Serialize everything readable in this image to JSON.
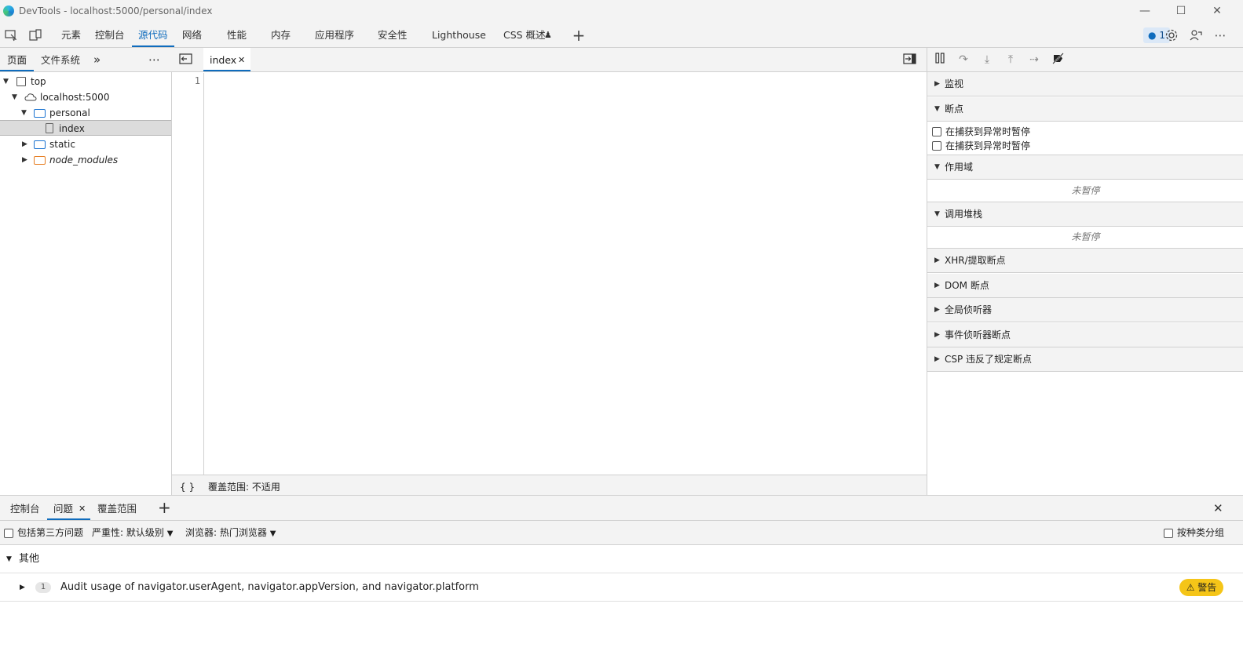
{
  "window": {
    "title": "DevTools - localhost:5000/personal/index",
    "minimize_glyph": "—",
    "maximize_glyph": "☐",
    "close_glyph": "✕"
  },
  "main_tabs": [
    {
      "label": "元素"
    },
    {
      "label": "控制台"
    },
    {
      "label": "源代码"
    },
    {
      "label": "网络"
    },
    {
      "label": "性能"
    },
    {
      "label": "内存"
    },
    {
      "label": "应用程序"
    },
    {
      "label": "安全性"
    },
    {
      "label": "Lighthouse"
    },
    {
      "label": "CSS 概述"
    }
  ],
  "active_main_tab": "源代码",
  "toolbar": {
    "add_tab_glyph": "+",
    "issues_count": "1",
    "more_glyph": "⋯",
    "experiment_glyph": "♟"
  },
  "navigator": {
    "tabs": [
      {
        "label": "页面"
      },
      {
        "label": "文件系统"
      }
    ],
    "more_tabs_glyph": "»",
    "menu_glyph": "⋯",
    "tree": [
      {
        "label": "top",
        "expanded": true
      },
      {
        "label": "localhost:5000",
        "expanded": true
      },
      {
        "label": "personal",
        "expanded": true
      },
      {
        "label": "index",
        "selected": true
      },
      {
        "label": "static",
        "expanded": false
      },
      {
        "label": "node_modules",
        "expanded": false,
        "italic": true
      }
    ]
  },
  "editor": {
    "open_file": "index",
    "close_glyph": "✕",
    "line_numbers": [
      "1"
    ],
    "pretty_print_glyph": "{ }",
    "coverage_status": "覆盖范围: 不适用"
  },
  "debugger": {
    "sections": {
      "watch": "监视",
      "breakpoints": "断点",
      "scope": "作用域",
      "call_stack": "调用堆栈",
      "xhr": "XHR/提取断点",
      "dom": "DOM 断点",
      "global_listeners": "全局侦听器",
      "event_listener_breakpoints": "事件侦听器断点",
      "csp": "CSP 违反了规定断点"
    },
    "breakpoint_options": [
      {
        "label": "在捕获到异常时暂停",
        "checked": false
      },
      {
        "label": "在捕获到异常时暂停",
        "checked": false
      }
    ],
    "scope_status": "未暂停",
    "call_stack_status": "未暂停"
  },
  "drawer": {
    "tabs": [
      {
        "label": "控制台"
      },
      {
        "label": "问题"
      },
      {
        "label": "覆盖范围"
      }
    ],
    "active_tab": "问题",
    "close_glyph": "✕",
    "add_glyph": "+",
    "include_third_party": "包括第三方问题",
    "severity": "严重性: 默认级别",
    "browser": "浏览器:  热门浏览器",
    "group_by_kind": "按种类分组",
    "group_title": "其他",
    "issue": {
      "count": "1",
      "text": "Audit usage of navigator.userAgent, navigator.appVersion, and navigator.platform",
      "badge": "⚠ 警告"
    }
  },
  "colors": {
    "accent": "#0f6cbd",
    "warning": "#f5c518",
    "toolbar_bg": "#f3f3f3",
    "folder_blue": "#1a73d1",
    "folder_orange": "#e67e22"
  }
}
